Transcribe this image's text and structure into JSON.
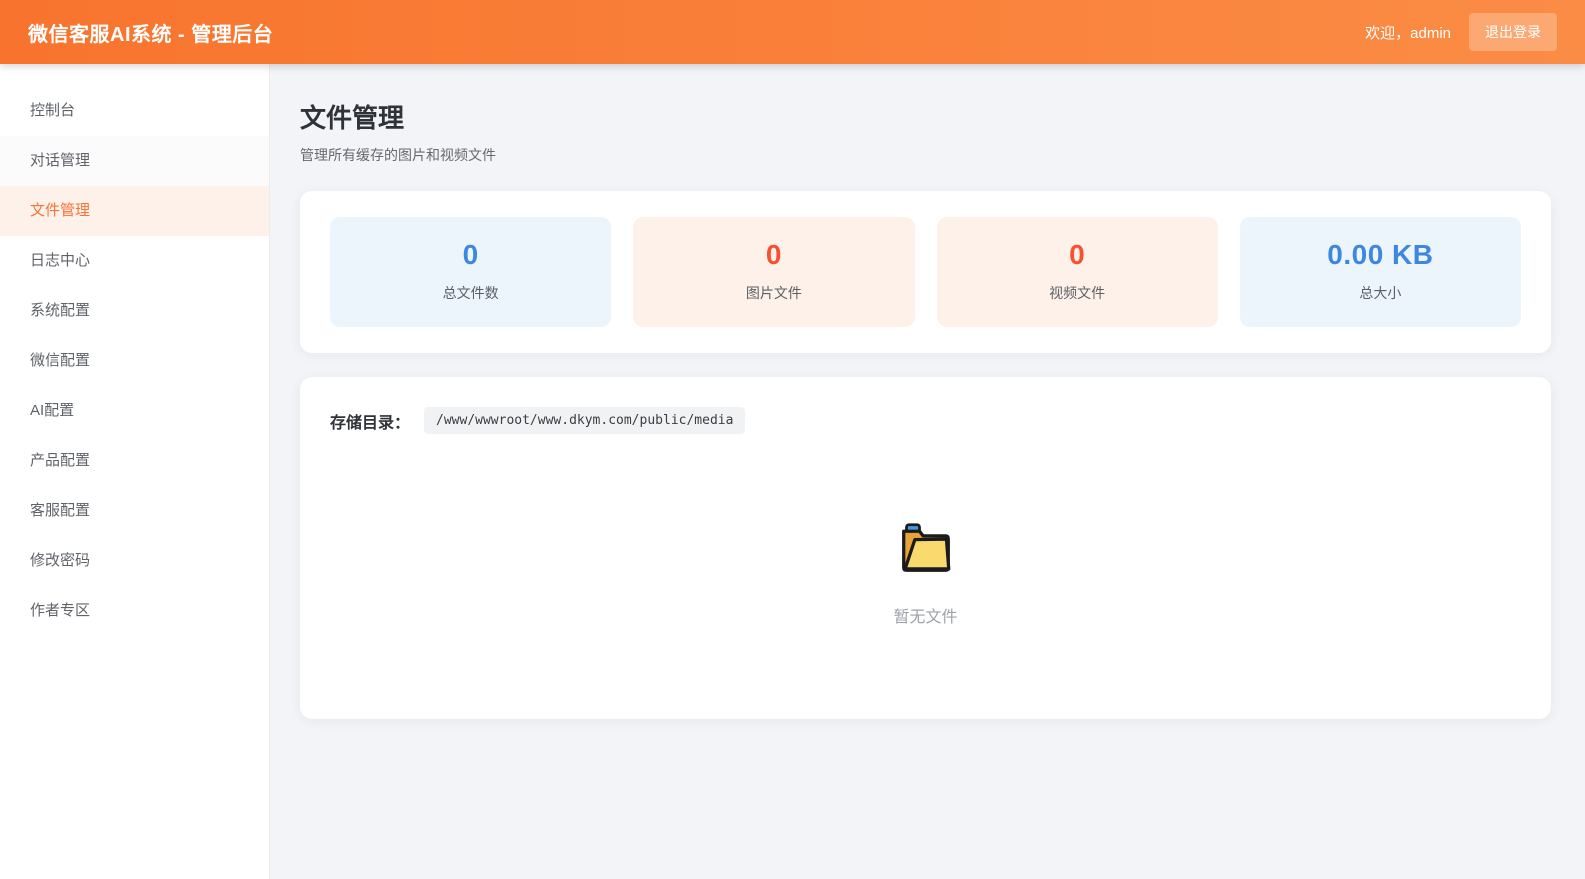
{
  "header": {
    "title": "微信客服AI系统 - 管理后台",
    "welcome": "欢迎，admin",
    "logout_label": "退出登录"
  },
  "sidebar": {
    "items": [
      {
        "label": "控制台",
        "active": false
      },
      {
        "label": "对话管理",
        "active": false
      },
      {
        "label": "文件管理",
        "active": true
      },
      {
        "label": "日志中心",
        "active": false
      },
      {
        "label": "系统配置",
        "active": false
      },
      {
        "label": "微信配置",
        "active": false
      },
      {
        "label": "AI配置",
        "active": false
      },
      {
        "label": "产品配置",
        "active": false
      },
      {
        "label": "客服配置",
        "active": false
      },
      {
        "label": "修改密码",
        "active": false
      },
      {
        "label": "作者专区",
        "active": false
      }
    ]
  },
  "page": {
    "title": "文件管理",
    "subtitle": "管理所有缓存的图片和视频文件"
  },
  "stats": [
    {
      "value": "0",
      "label": "总文件数",
      "theme": "blue"
    },
    {
      "value": "0",
      "label": "图片文件",
      "theme": "orange"
    },
    {
      "value": "0",
      "label": "视频文件",
      "theme": "orange"
    },
    {
      "value": "0.00 KB",
      "label": "总大小",
      "theme": "blue"
    }
  ],
  "storage": {
    "label": "存储目录：",
    "path": "/www/wwwroot/www.dkym.com/public/media"
  },
  "empty": {
    "icon": "open-folder-icon",
    "text": "暂无文件"
  },
  "colors": {
    "header_gradient_start": "#f8742e",
    "header_gradient_end": "#fb8c45",
    "active_menu_text": "#f97338",
    "active_menu_bg": "#fdf1e9",
    "stat_blue_text": "#3d87e0",
    "stat_blue_bg": "#ecf4fc",
    "stat_orange_text": "#f9512e",
    "stat_orange_bg": "#fdf1ea",
    "main_bg": "#f3f4f7"
  }
}
